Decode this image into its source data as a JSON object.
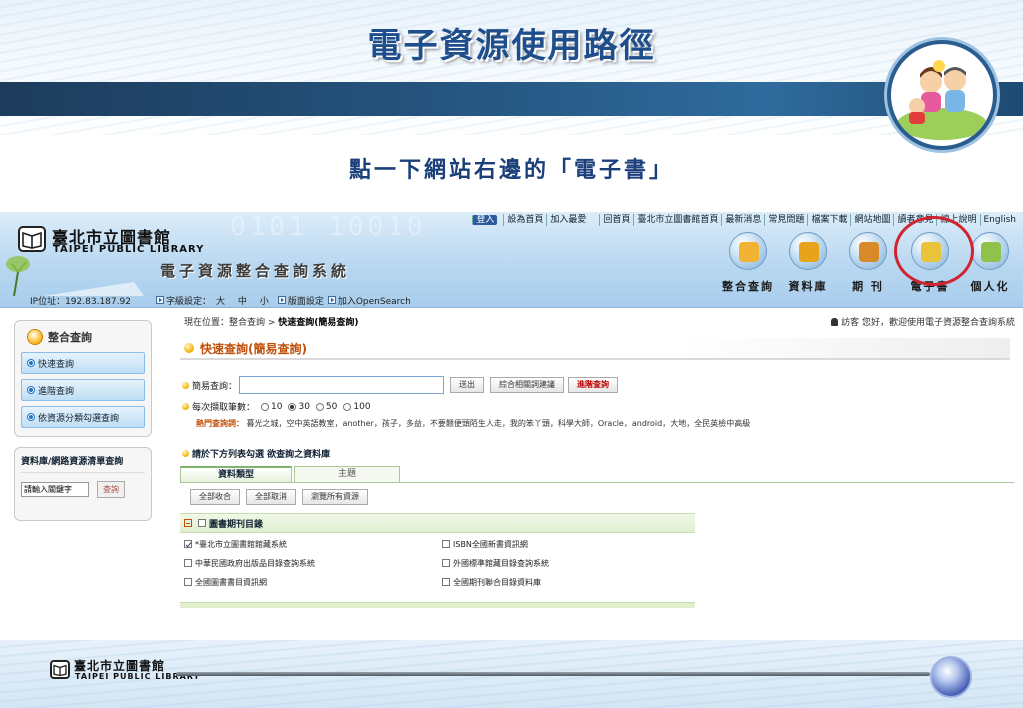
{
  "slide": {
    "title": "電子資源使用路徑",
    "instruction": "點一下網站右邊的「電子書」",
    "footer_logo_cn": "臺北市立圖書館",
    "footer_logo_en": "TAIPEI PUBLIC LIBRARY"
  },
  "site": {
    "logo_cn": "臺北市立圖書館",
    "logo_en": "TAIPEI PUBLIC LIBRARY",
    "subtitle": "電子資源整合查詢系統",
    "login_label": "登入",
    "top_links": [
      "設為首頁",
      "加入最愛",
      "回首頁",
      "臺北市立圖書館首頁",
      "最新消息",
      "常見問題",
      "檔案下載",
      "網站地圖",
      "讀者意見",
      "線上說明",
      "English"
    ],
    "nav": [
      {
        "label": "整合查詢",
        "icon": "search-globe-icon",
        "color": "#f2b233"
      },
      {
        "label": "資料庫",
        "icon": "database-chart-icon",
        "color": "#e7a31b"
      },
      {
        "label": "期 刊",
        "icon": "journal-books-icon",
        "color": "#d98a28"
      },
      {
        "label": "電子書",
        "icon": "ebook-cd-icon",
        "color": "#e9c43a"
      },
      {
        "label": "個人化",
        "icon": "personal-puzzle-icon",
        "color": "#8fc24a"
      }
    ],
    "ip_text": "IP位址：192.83.187.92",
    "font_setting_label": "字級設定：",
    "font_sizes": [
      "大",
      "中",
      "小"
    ],
    "layout_setting": "版面設定",
    "opensearch": "加入OpenSearch",
    "sidebar": {
      "title": "整合查詢",
      "items": [
        "快速查詢",
        "進階查詢",
        "依資源分類勾選查詢"
      ],
      "db_search_title": "資料庫/網路資源清單查詢",
      "db_search_value": "請輸入關鍵字",
      "db_search_button": "查詢"
    },
    "breadcrumb_prefix": "現在位置：整合查詢 > ",
    "breadcrumb_current": "快速查詢(簡易查詢)",
    "greeting": "訪客 您好，歡迎使用電子資源整合查詢系統",
    "section_title": "快速查詢(簡易查詢)",
    "query_label": "簡易查詢：",
    "query_value": "",
    "buttons": {
      "submit": "送出",
      "related": "綜合相關詞建議",
      "advanced": "進階查詢"
    },
    "count_label": "每次擷取筆數：",
    "count_options": [
      "10",
      "30",
      "50",
      "100"
    ],
    "count_selected": "30",
    "hot_label": "熱門查詢詞：",
    "hot_terms": "暮光之城，空中英語教室，another，孩子，多益，不要餵便頭陌生人走，我的笨丫頭，科學大師，Oracle，android，大地，全民英檢中高級",
    "select_prompt": "請於下方列表勾選 欲查詢之資料庫",
    "tabs": [
      "資料類型",
      "主題"
    ],
    "panel_buttons": [
      "全部收合",
      "全部取消",
      "瀏覽所有資源"
    ],
    "group_title": "圖書期刊目錄",
    "databases": [
      {
        "label": "*臺北市立圖書館館藏系統",
        "checked": true
      },
      {
        "label": "ISBN全國新書資訊網",
        "checked": false
      },
      {
        "label": "中華民國政府出版品目錄查詢系統",
        "checked": false
      },
      {
        "label": "外國標準館藏目錄查詢系統",
        "checked": false
      },
      {
        "label": "全國圖書書目資訊網",
        "checked": false
      },
      {
        "label": "全國期刊聯合目錄資料庫",
        "checked": false
      }
    ]
  }
}
